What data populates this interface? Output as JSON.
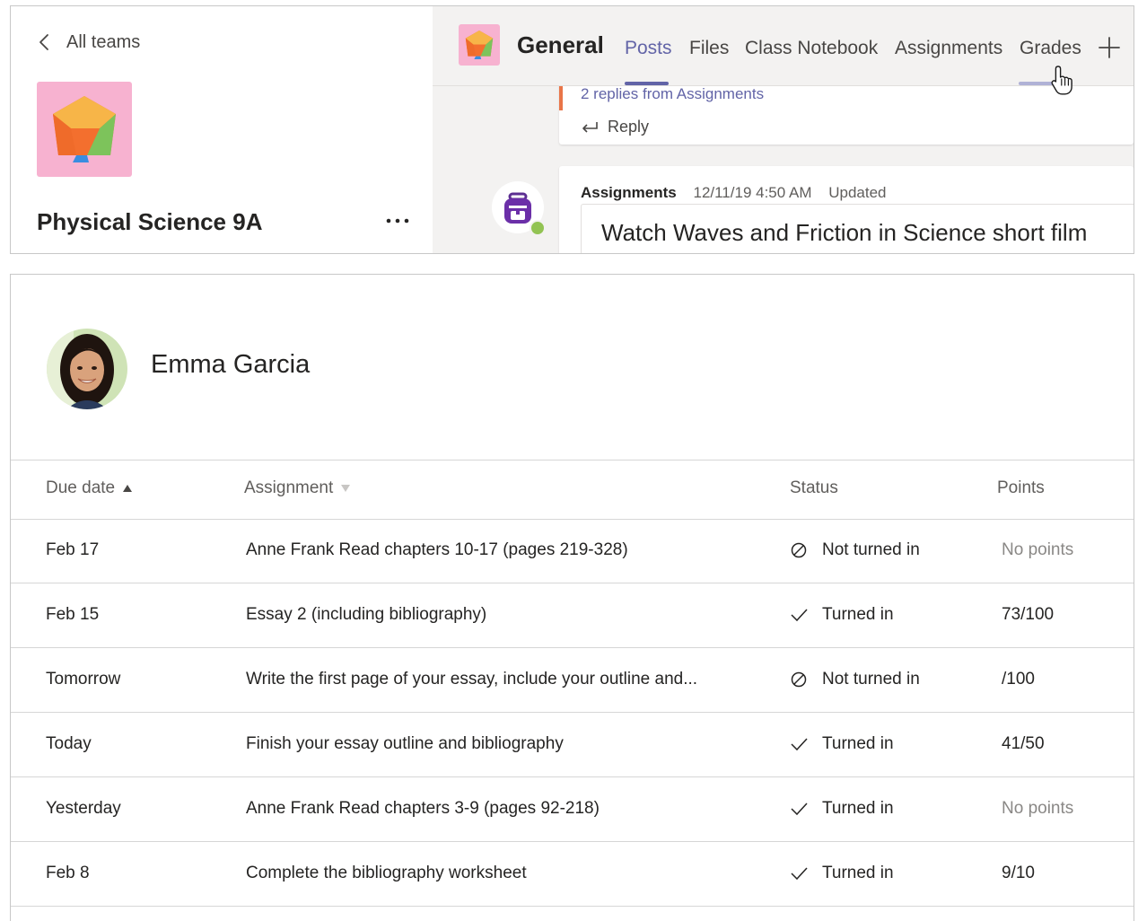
{
  "team": {
    "back_label": "All teams",
    "name": "Physical Science 9A"
  },
  "channel": {
    "name": "General",
    "tabs": [
      {
        "label": "Posts",
        "active": true
      },
      {
        "label": "Files"
      },
      {
        "label": "Class Notebook"
      },
      {
        "label": "Assignments"
      },
      {
        "label": "Grades",
        "hovered": true
      }
    ]
  },
  "feed": {
    "replies_text": "2 replies from Assignments",
    "reply_label": "Reply",
    "post": {
      "author": "Assignments",
      "timestamp": "12/11/19 4:50 AM",
      "status": "Updated",
      "title": "Watch Waves and Friction in Science short film"
    }
  },
  "student": {
    "name": "Emma Garcia"
  },
  "table": {
    "headers": {
      "due": "Due date",
      "assignment": "Assignment",
      "status": "Status",
      "points": "Points"
    },
    "rows": [
      {
        "due": "Feb 17",
        "assignment": "Anne Frank Read chapters 10-17 (pages 219-328)",
        "status": "Not turned in",
        "status_icon": "not-turned-in-icon",
        "points": "No points"
      },
      {
        "due": "Feb 15",
        "assignment": "Essay 2 (including bibliography)",
        "status": "Turned in",
        "status_icon": "check-icon",
        "points": "73/100"
      },
      {
        "due": "Tomorrow",
        "assignment": "Write the first page of your essay, include your outline and...",
        "status": "Not turned in",
        "status_icon": "not-turned-in-icon",
        "points": "/100"
      },
      {
        "due": "Today",
        "assignment": "Finish your essay outline and bibliography",
        "status": "Turned in",
        "status_icon": "check-icon",
        "points": "41/50"
      },
      {
        "due": "Yesterday",
        "assignment": "Anne Frank Read chapters 3-9 (pages 92-218)",
        "status": "Turned in",
        "status_icon": "check-icon",
        "points": "No points"
      },
      {
        "due": "Feb 8",
        "assignment": "Complete the bibliography worksheet",
        "status": "Turned in",
        "status_icon": "check-icon",
        "points": "9/10"
      }
    ]
  },
  "colors": {
    "accent": "#6264a7",
    "team_logo_bg": "#f7b2d0",
    "reply_bar": "#e97548",
    "presence": "#92c353"
  }
}
